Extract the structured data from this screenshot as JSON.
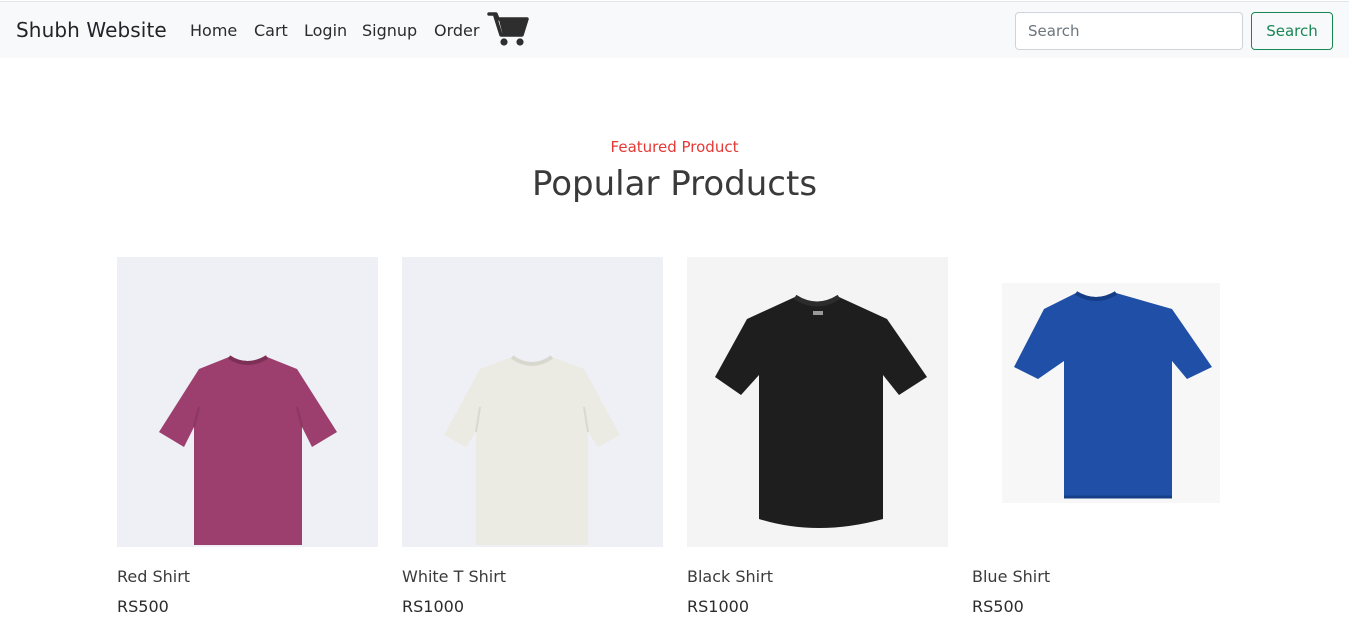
{
  "navbar": {
    "brand": "Shubh Website",
    "links": [
      "Home",
      "Cart",
      "Login",
      "Signup",
      "Order"
    ],
    "cart_icon": "shopping-cart-icon",
    "search_placeholder": "Search",
    "search_value": "",
    "search_button": "Search"
  },
  "section": {
    "kicker": "Featured Product",
    "title": "Popular Products"
  },
  "products": [
    {
      "name": "Red Shirt",
      "price": "RS500",
      "color": "#9c3f6e"
    },
    {
      "name": "White T Shirt",
      "price": "RS1000",
      "color": "#ecece4"
    },
    {
      "name": "Black Shirt",
      "price": "RS1000",
      "color": "#1e1e1e"
    },
    {
      "name": "Blue Shirt",
      "price": "RS500",
      "color": "#1f4fa6"
    }
  ],
  "colors": {
    "navbar_bg": "#f8f9fa",
    "accent_green": "#198754",
    "kicker_red": "#e53935"
  }
}
